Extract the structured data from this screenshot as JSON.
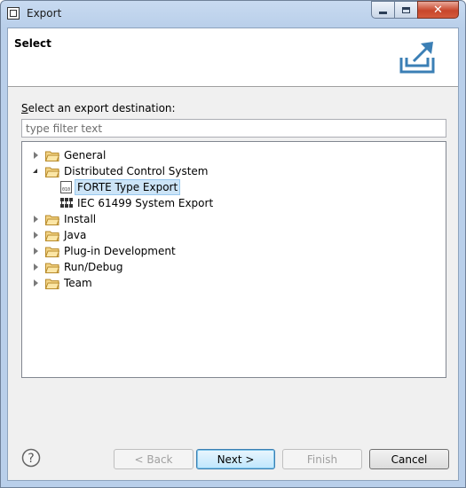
{
  "window": {
    "title": "Export"
  },
  "header": {
    "title": "Select"
  },
  "destination_label_prefix": "S",
  "destination_label_rest": "elect an export destination:",
  "filter": {
    "placeholder": "type filter text",
    "value": ""
  },
  "tree": {
    "items": [
      {
        "label": "General",
        "state": "collapsed"
      },
      {
        "label": "Distributed Control System",
        "state": "expanded",
        "children": [
          {
            "label": "FORTE Type Export",
            "selected": true,
            "icon": "forte-file-icon"
          },
          {
            "label": "IEC 61499 System Export",
            "selected": false,
            "icon": "system-network-icon"
          }
        ]
      },
      {
        "label": "Install",
        "state": "collapsed"
      },
      {
        "label": "Java",
        "state": "collapsed"
      },
      {
        "label": "Plug-in Development",
        "state": "collapsed"
      },
      {
        "label": "Run/Debug",
        "state": "collapsed"
      },
      {
        "label": "Team",
        "state": "collapsed"
      }
    ]
  },
  "buttons": {
    "back": {
      "label": "< Back",
      "enabled": false
    },
    "next": {
      "label": "Next >",
      "enabled": true
    },
    "finish": {
      "label": "Finish",
      "enabled": false
    },
    "cancel": {
      "label": "Cancel",
      "enabled": true
    }
  },
  "icons": {
    "help": "help-icon",
    "banner": "export-banner-icon",
    "folder": "folder-icon"
  },
  "colors": {
    "selection_bg": "#cce4f7",
    "folder": "#e8c46a",
    "frame": "#b9cfea"
  }
}
